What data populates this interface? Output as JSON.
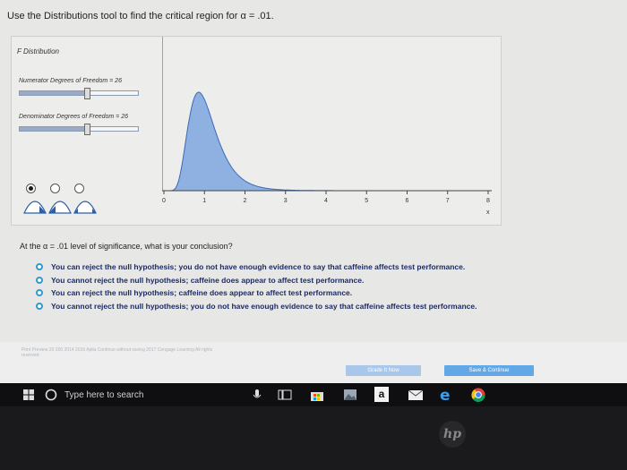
{
  "question": {
    "prefix": "Use the Distributions tool to find the critical region for",
    "alpha_symbol": "α",
    "suffix": "= .01."
  },
  "tool": {
    "title": "F Distribution",
    "numerator": {
      "label": "Numerator Degrees of Freedom = 26",
      "value": 26
    },
    "denominator": {
      "label": "Denominator Degrees of Freedom = 26",
      "value": 26
    },
    "selected_mode": 0,
    "chart_data": {
      "type": "area",
      "distribution": "F",
      "df1": 26,
      "df2": 26,
      "xlim": [
        0,
        8
      ],
      "ticks": [
        "0",
        "1",
        "2",
        "3",
        "4",
        "5",
        "6",
        "7",
        "8"
      ],
      "xlabel": "x"
    }
  },
  "conclusion": {
    "prompt_prefix": "At the",
    "alpha_symbol": "α",
    "prompt_suffix": "= .01 level of significance, what is your conclusion?",
    "options": [
      "You can reject the null hypothesis; you do not have enough evidence to say that caffeine affects test performance.",
      "You cannot reject the null hypothesis; caffeine does appear to affect test performance.",
      "You can reject the null hypothesis; caffeine does appear to affect test performance.",
      "You cannot reject the null hypothesis; you do not have enough evidence to say that caffeine affects test performance."
    ]
  },
  "footer": {
    "grade_label": "Grade It Now",
    "save_label": "Save & Continue",
    "fine_print": "Print Preview 20 200 2014 2016 Aplia Continue without saving 2017 Cengage Learning All rights reserved"
  },
  "taskbar": {
    "search_placeholder": "Type here to search",
    "amazon_letter": "a"
  },
  "colors": {
    "curve_fill": "#8fb1e2",
    "curve_stroke": "#3c68b8",
    "option_ring": "#2e9bd0",
    "grade_button": "#a9c7ea",
    "save_button": "#63a8e6"
  }
}
